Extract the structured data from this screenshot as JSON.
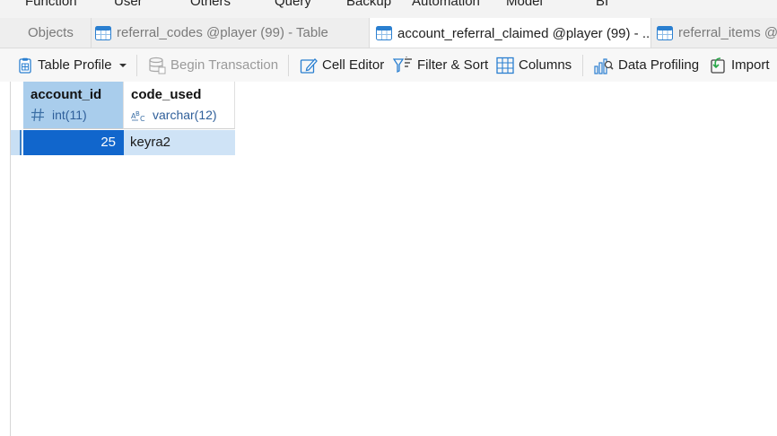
{
  "main_menu": [
    "Function",
    "User",
    "Others",
    "Query",
    "Backup",
    "Automation",
    "Model",
    "BI"
  ],
  "tabs": [
    {
      "label": "Objects",
      "active": false,
      "icon": "none"
    },
    {
      "label": "referral_codes @player (99) - Table",
      "active": false,
      "icon": "table-icon"
    },
    {
      "label": "account_referral_claimed @player (99) - ...",
      "active": true,
      "icon": "table-icon"
    },
    {
      "label": "referral_items @p",
      "active": false,
      "icon": "table-icon"
    }
  ],
  "toolbar": {
    "table_profile": "Table Profile",
    "begin_transaction": "Begin Transaction",
    "cell_editor": "Cell Editor",
    "filter_sort": "Filter & Sort",
    "columns": "Columns",
    "data_profiling": "Data Profiling",
    "import": "Import"
  },
  "grid": {
    "columns": [
      {
        "name": "account_id",
        "type": "int(11)",
        "type_icon": "number-hash-icon",
        "selected": true
      },
      {
        "name": "code_used",
        "type": "varchar(12)",
        "type_icon": "text-abc-icon",
        "selected": false
      }
    ],
    "rows": [
      {
        "account_id": "25",
        "code_used": "keyra2"
      }
    ]
  },
  "colors": {
    "selected_cell": "#1166cc",
    "selected_row": "#cfe3f6",
    "selected_header": "#a9cdec",
    "type_text": "#2f5f9a"
  }
}
